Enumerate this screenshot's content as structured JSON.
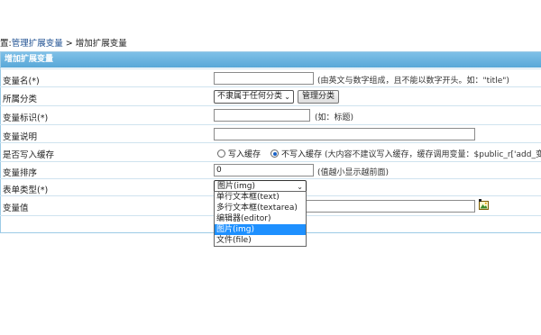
{
  "breadcrumb": {
    "prefix": "置:",
    "link": "管理扩展变量",
    "sep": " > ",
    "current": "增加扩展变量"
  },
  "panel_title": "增加扩展变量",
  "fields": {
    "var_name": {
      "label": "变量名(*)",
      "value": "",
      "hint": "(由英文与数字组成，且不能以数字开头。如：\"title\")"
    },
    "category": {
      "label": "所属分类",
      "selected": "不隶属于任何分类",
      "button": "管理分类"
    },
    "var_id": {
      "label": "变量标识(*)",
      "value": "",
      "hint": "(如：标题)"
    },
    "var_desc": {
      "label": "变量说明",
      "value": ""
    },
    "cache": {
      "label": "是否写入缓存",
      "opt_yes": "写入缓存",
      "opt_no": "不写入缓存",
      "hint": "(大内容不建议写入缓存，缓存调用变量：$public_r['add_变量"
    },
    "sort": {
      "label": "变量排序",
      "value": "0",
      "hint": "(值越小显示越前面)"
    },
    "form_type": {
      "label": "表单类型(*)",
      "selected": "图片(img)",
      "options": [
        "单行文本框(text)",
        "多行文本框(textarea)",
        "编辑器(editor)",
        "图片(img)",
        "文件(file)"
      ],
      "highlighted_index": 3
    },
    "var_value": {
      "label": "变量值",
      "value": ""
    }
  },
  "icons": {
    "image_picker": "image-picker-icon"
  }
}
